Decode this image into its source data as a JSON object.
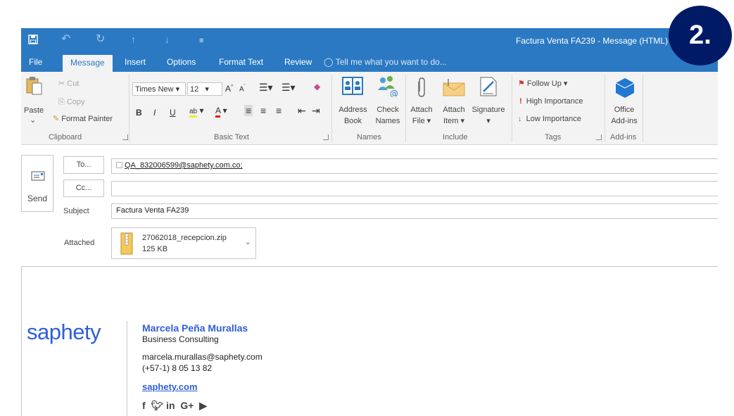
{
  "window": {
    "title": "Factura Venta FA239 - Message (HTML)"
  },
  "quick_access": [
    "save-icon",
    "undo-icon",
    "redo-icon",
    "up-arrow-icon",
    "down-arrow-icon",
    "customize-icon"
  ],
  "tabs": [
    {
      "label": "File"
    },
    {
      "label": "Message"
    },
    {
      "label": "Insert"
    },
    {
      "label": "Options"
    },
    {
      "label": "Format Text"
    },
    {
      "label": "Review"
    }
  ],
  "tell_me": "Tell me what you want to do...",
  "ribbon": {
    "clipboard": {
      "paste": "Paste",
      "cut": "Cut",
      "copy": "Copy",
      "format_painter": "Format Painter",
      "label": "Clipboard"
    },
    "basic_text": {
      "font_name": "Times New",
      "font_size": "12",
      "bold": "B",
      "italic": "I",
      "underline": "U",
      "label": "Basic Text"
    },
    "names": {
      "address_book_1": "Address",
      "address_book_2": "Book",
      "check_names_1": "Check",
      "check_names_2": "Names",
      "label": "Names"
    },
    "include": {
      "attach_file_1": "Attach",
      "attach_file_2": "File",
      "attach_item_1": "Attach",
      "attach_item_2": "Item",
      "signature": "Signature",
      "label": "Include"
    },
    "tags": {
      "follow_up": "Follow Up",
      "high_importance": "High Importance",
      "low_importance": "Low Importance",
      "label": "Tags"
    },
    "addins": {
      "office_1": "Office",
      "office_2": "Add-ins",
      "label": "Add-ins"
    }
  },
  "compose": {
    "send": "Send",
    "to_button": "To...",
    "cc_button": "Cc...",
    "to_value": "QA_832006599@saphety.com.co;",
    "cc_value": "",
    "subject_label": "Subject",
    "subject_value": "Factura Venta FA239",
    "attached_label": "Attached",
    "attachment": {
      "name": "27062018_recepcion.zip",
      "size": "125 KB"
    }
  },
  "signature": {
    "logo": "saphety",
    "name": "Marcela Peña Murallas",
    "role": "Business Consulting",
    "email": "marcela.murallas@saphety.com",
    "phone": "(+57-1) 8 05 13 82",
    "website": "saphety.com",
    "social": [
      "facebook-icon",
      "twitter-icon",
      "linkedin-icon",
      "google-plus-icon",
      "youtube-icon"
    ]
  },
  "badge": "2.",
  "colors": {
    "titlebar": "#2b79c2",
    "ribbon_bg": "#f3f3f3",
    "badge_bg": "#001a66",
    "signature_name": "#2f5fd6",
    "logo": "#2f5fd6"
  }
}
